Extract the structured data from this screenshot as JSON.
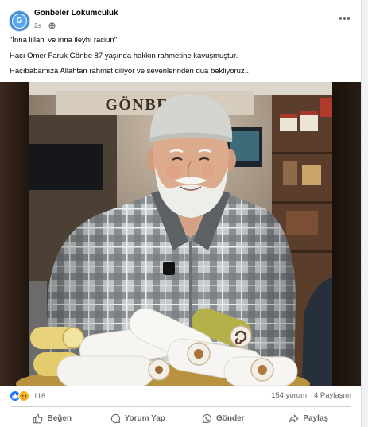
{
  "post": {
    "avatar_text": "G",
    "page_name": "Gönbeler Lokumculuk",
    "time": "2s",
    "separator": "·",
    "privacy_icon": "globe-icon",
    "more_icon": "more-options-icon",
    "lines": [
      "\"İnna lillahi ve inna ileyhi raciun\"",
      "Hacı Ömer Faruk Gönbe 87 yaşında hakkın rahmetine kavuşmuştur.",
      "Hacıbabamıza Allahtan rahmet diliyor ve sevenlerinden dua bekliyoruz.."
    ]
  },
  "photo": {
    "sign_text": "GÖNBELER"
  },
  "stats": {
    "reaction_icons": [
      "like-reaction-icon",
      "sad-reaction-icon"
    ],
    "reaction_count": "118",
    "comments": "154 yorum",
    "shares": "4 Paylaşım"
  },
  "actions": [
    {
      "label": "Beğen",
      "icon": "like-icon"
    },
    {
      "label": "Yorum Yap",
      "icon": "comment-icon"
    },
    {
      "label": "Gönder",
      "icon": "send-icon"
    },
    {
      "label": "Paylaş",
      "icon": "share-icon"
    }
  ],
  "colors": {
    "text": "#050505",
    "secondary": "#65676b",
    "like_blue": "#1877f2",
    "sad_yellow": "#f7b125",
    "card": "#ffffff",
    "page_bg": "#f0f2f5"
  }
}
